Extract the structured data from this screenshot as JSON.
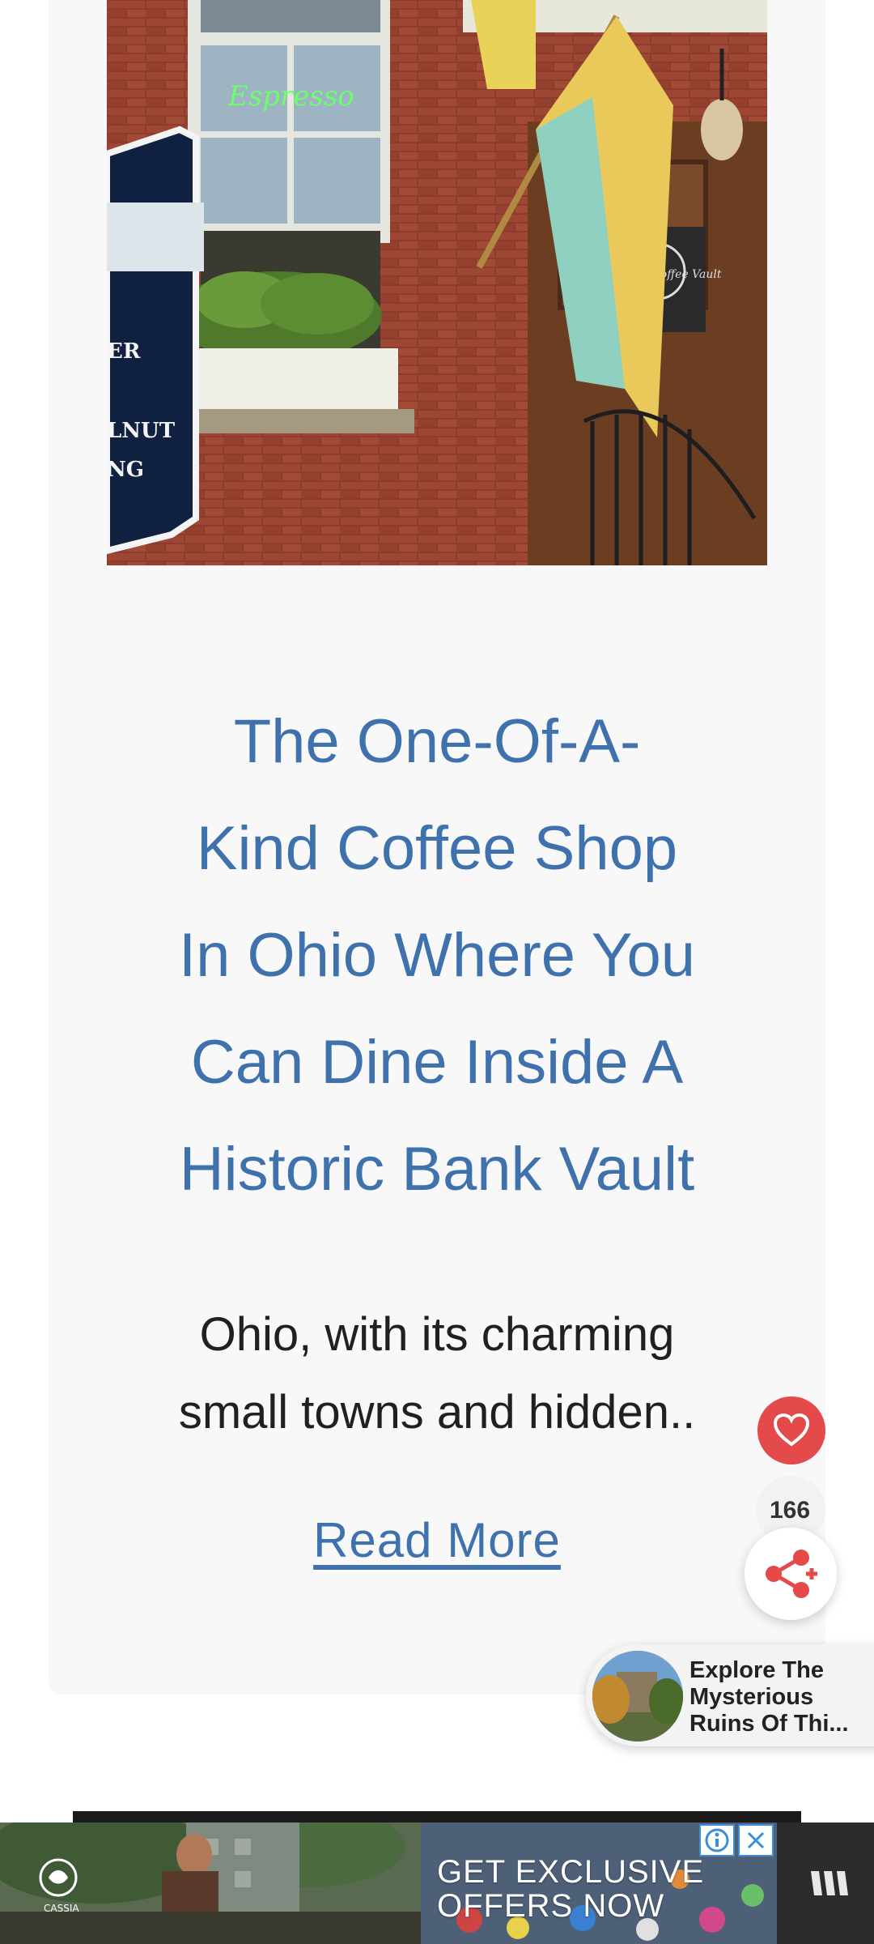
{
  "article": {
    "title_lines": [
      "The One-Of-A-",
      "Kind Coffee Shop",
      "In Ohio Where You",
      "Can Dine Inside A",
      "Historic Bank Vault"
    ],
    "excerpt_lines": [
      "Ohio, with its charming",
      "small towns and hidden.."
    ],
    "read_more": "Read More",
    "image_sign": {
      "sign_fragments": [
        "ER",
        "LNUT",
        "NG"
      ],
      "neon_text": "Espresso",
      "window_decal": "The Coffee Vault"
    }
  },
  "share": {
    "count": "166",
    "heart_icon": "heart-icon",
    "share_icon": "share-icon"
  },
  "recommendation": {
    "lines": [
      "Explore The",
      "Mysterious",
      "Ruins Of Thi..."
    ]
  },
  "ad": {
    "brand": "CASSIA",
    "offer_lines": [
      "GET EXCLUSIVE",
      "OFFERS NOW"
    ],
    "info_icon": "info-icon",
    "close_icon": "close-icon"
  },
  "colors": {
    "title": "#3f72ad",
    "heart": "#e54a4a",
    "card_bg": "#f8f8f8"
  }
}
